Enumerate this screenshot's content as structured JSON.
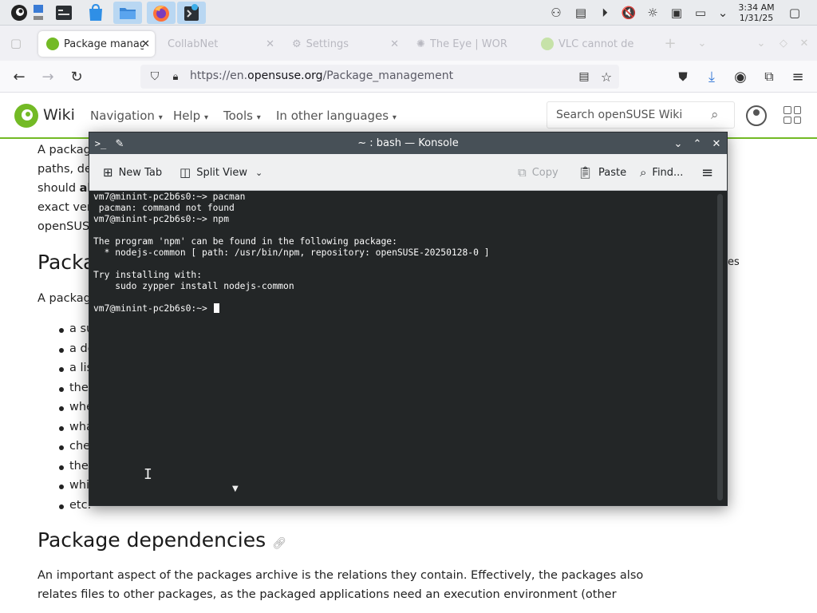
{
  "taskbar": {
    "launchers": [
      "opensuse-logo-icon",
      "desktop-icon",
      "terminal-app-icon",
      "store-icon",
      "file-manager-icon",
      "firefox-icon",
      "konsole-icon"
    ],
    "clock_time": "3:34 AM",
    "clock_date": "1/31/25"
  },
  "browser": {
    "tabs": [
      {
        "title": "Package manag",
        "active": true
      },
      {
        "title": "CollabNet",
        "active": false
      },
      {
        "title": "Settings",
        "active": false
      },
      {
        "title": "The Eye | WOR",
        "active": false
      },
      {
        "title": "VLC cannot de",
        "active": false
      }
    ],
    "url_prefix": "https://en.",
    "url_host": "opensuse.org",
    "url_path": "/Package_management"
  },
  "wiki": {
    "site_name": "Wiki",
    "menu": [
      "Navigation",
      "Help",
      "Tools",
      "In other languages"
    ],
    "search_placeholder": "Search openSUSE Wiki",
    "intro_lines": [
      "A package",
      "paths, dep",
      "should",
      "al",
      "exact vers",
      "openSUSE"
    ],
    "section1_heading": "Packa",
    "section1_intro": "A package",
    "side_clip": "es",
    "bullets": [
      "a su",
      "a de",
      "a lis",
      "the",
      "whe",
      "wha",
      "che",
      "the",
      "whi",
      "etc."
    ],
    "section2_heading": "Package dependencies",
    "section2_lines": [
      "An important aspect of the packages archive is the relations they contain. Effectively, the packages also",
      "relates files to other packages, as the packaged applications need an execution environment (other"
    ]
  },
  "konsole": {
    "title": "~ : bash — Konsole",
    "toolbar": {
      "new_tab": "New Tab",
      "split_view": "Split View",
      "copy": "Copy",
      "paste": "Paste",
      "find": "Find..."
    },
    "lines": [
      "vm7@minint-pc2b6s0:~> pacman",
      " pacman: command not found",
      "vm7@minint-pc2b6s0:~> npm",
      "",
      "The program 'npm' can be found in the following package:",
      "  * nodejs-common [ path: /usr/bin/npm, repository: openSUSE-20250128-0 ]",
      "",
      "Try installing with:",
      "    sudo zypper install nodejs-common",
      ""
    ],
    "prompt": "vm7@minint-pc2b6s0:~> "
  }
}
